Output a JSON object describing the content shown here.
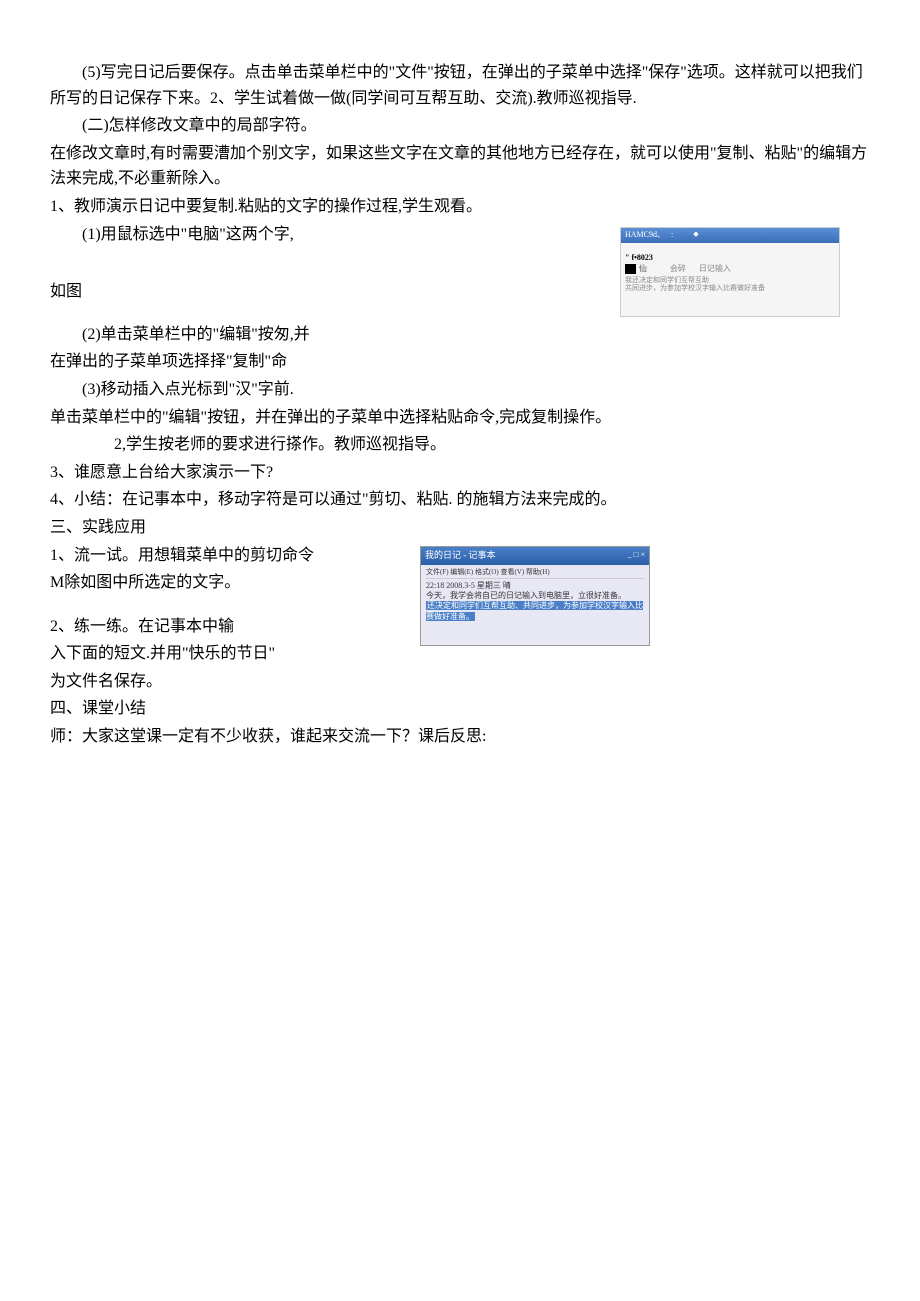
{
  "para1": "(5)写完日记后要保存。点击单击菜单栏中的\"文件\"按钮，在弹出的子菜单中选择\"保存\"选项。这样就可以把我们所写的日记保存下来。2、学生试着做一做(同学间可互帮互助、交流).教师巡视指导.",
  "para2": "(二)怎样修改文章中的局部字符。",
  "para3": "在修改文章时,有时需要漕加个别文字，如果这些文字在文章的其他地方已经存在，就可以使用\"复制、粘贴\"的编辑方法来完成,不必重新除入。",
  "para4": "1、教师演示日记中要复制.粘贴的文字的操作过程,学生观看。",
  "para5": "(1)用鼠标选中\"电脑\"这两个字,",
  "para6": "如图",
  "para7": "(2)单击菜单栏中的\"编辑\"按匆,并",
  "para8": "在弹出的子菜单项选择择\"复制\"命",
  "para9": "(3)移动插入点光标到\"汉\"字前.",
  "para10": "单击菜单栏中的\"编辑\"按钮，并在弹出的子菜单中选择粘贴命令,完成复制操作。",
  "para11": "2,学生按老师的要求进行搽作。教师巡视指导。",
  "para12": "3、谁愿意上台给大家演示一下?",
  "para13": "4、小结：在记事本中，移动字符是可以通过\"剪切、粘贴. 的施辑方法来完成的。",
  "para14": "三、实践应用",
  "para15": "1、流一试。用想辑菜单中的剪切命令",
  "para16": "M除如图中所选定的文字。",
  "para17": "2、练一练。在记事本中输",
  "para18": "入下面的短文.并用\"快乐的节日\"",
  "para19": "为文件名保存。",
  "para20": "四、课堂小结",
  "para21": "师：大家这堂课一定有不少收获，谁起来交流一下？课后反思:",
  "img1": {
    "titlebar": "HAMC9d、",
    "code": "\" f•8023",
    "ch": "仙",
    "text1": "会碎",
    "text2": "日记输入",
    "text3": "我还决定和同学们互帮互助",
    "text4": "共同进步，为参加学校汉字输入比赛做好准备"
  },
  "img2": {
    "title": "我的日记 - 记事本",
    "menu": "文件(F) 编辑(E) 格式(O) 查看(V) 帮助(H)",
    "line1": "22:18 2008.3-5 星期三 晴",
    "line2": "今天，我学会将自已的日记输入到电脑里，立很好准备。",
    "line3": "还决定和同学们互帮互助、共同进步，为参加学校汉字输入比赛做好准备。"
  }
}
